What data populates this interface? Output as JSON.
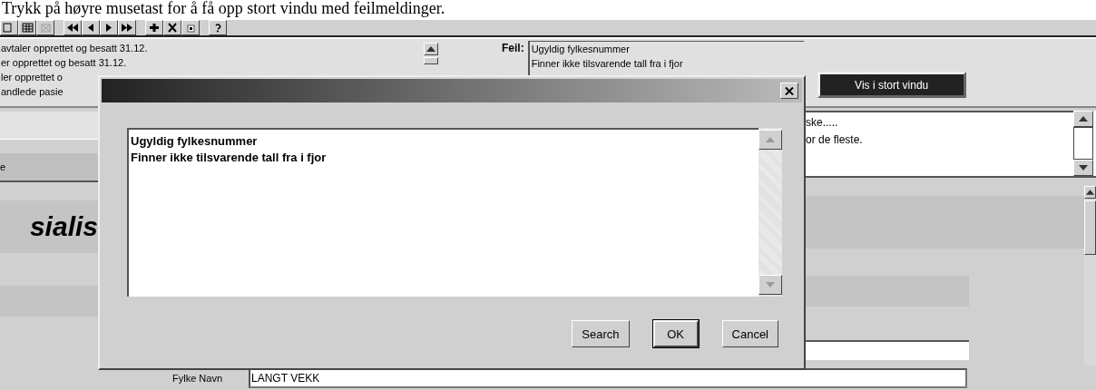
{
  "caption": "Trykk på høyre musetast for å få opp stort vindu med feilmeldinger.",
  "message_list": {
    "lines": [
      "avtaler opprettet og besatt 31.12.",
      "er opprettet og besatt 31.12.",
      "ler opprettet o",
      "andlede pasie"
    ]
  },
  "error_panel": {
    "label": "Feil:",
    "lines": [
      "Ugyldig fylkesnummer",
      "Finner ikke tilsvarende tall fra i fjor"
    ]
  },
  "show_large_button": "Vis i stort vindu",
  "comment_box": {
    "lines": [
      "ske.....",
      "or de fleste."
    ]
  },
  "left_fragments": {
    "column_label": "e",
    "heading": "sialis"
  },
  "form": {
    "fields": [
      {
        "label": "Fylke Navn",
        "value": "LANGT VEKK"
      }
    ]
  },
  "dialog": {
    "text_lines": [
      "Ugyldig fylkesnummer",
      "Finner ikke tilsvarende tall fra i fjor"
    ],
    "buttons": [
      {
        "label": "Search",
        "default": false
      },
      {
        "label": "OK",
        "default": true
      },
      {
        "label": "Cancel",
        "default": false
      }
    ]
  }
}
